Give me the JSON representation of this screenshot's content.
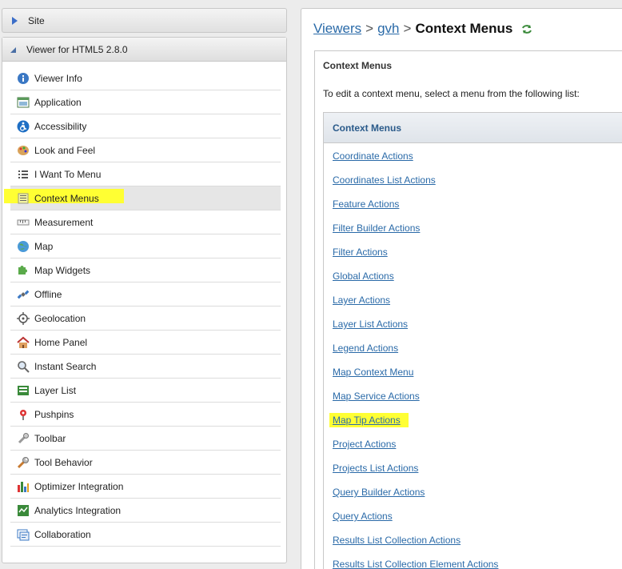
{
  "sidebar": {
    "site_label": "Site",
    "viewer_label": "Viewer for HTML5 2.8.0",
    "items": [
      {
        "label": "Viewer Info",
        "icon": "info-icon"
      },
      {
        "label": "Application",
        "icon": "application-icon"
      },
      {
        "label": "Accessibility",
        "icon": "accessibility-icon"
      },
      {
        "label": "Look and Feel",
        "icon": "palette-icon"
      },
      {
        "label": "I Want To Menu",
        "icon": "list-icon"
      },
      {
        "label": "Context Menus",
        "icon": "context-menu-icon"
      },
      {
        "label": "Measurement",
        "icon": "ruler-icon"
      },
      {
        "label": "Map",
        "icon": "globe-icon"
      },
      {
        "label": "Map Widgets",
        "icon": "puzzle-icon"
      },
      {
        "label": "Offline",
        "icon": "satellite-icon"
      },
      {
        "label": "Geolocation",
        "icon": "crosshair-icon"
      },
      {
        "label": "Home Panel",
        "icon": "home-icon"
      },
      {
        "label": "Instant Search",
        "icon": "search-icon"
      },
      {
        "label": "Layer List",
        "icon": "layers-icon"
      },
      {
        "label": "Pushpins",
        "icon": "pushpin-icon"
      },
      {
        "label": "Toolbar",
        "icon": "toolbar-icon"
      },
      {
        "label": "Tool Behavior",
        "icon": "wrench-icon"
      },
      {
        "label": "Optimizer Integration",
        "icon": "bar-chart-icon"
      },
      {
        "label": "Analytics Integration",
        "icon": "analytics-icon"
      },
      {
        "label": "Collaboration",
        "icon": "collaboration-icon"
      }
    ],
    "active_index": 5
  },
  "breadcrumb": {
    "viewers": "Viewers",
    "sep": ">",
    "gvh": "gvh",
    "current": "Context Menus"
  },
  "panel": {
    "title": "Context Menus",
    "description": "To edit a context menu, select a menu from the following list:",
    "list_header": "Context Menus",
    "menus": [
      "Coordinate Actions",
      "Coordinates List Actions",
      "Feature Actions",
      "Filter Builder Actions",
      "Filter Actions",
      "Global Actions",
      "Layer Actions",
      "Layer List Actions",
      "Legend Actions",
      "Map Context Menu",
      "Map Service Actions",
      "Map Tip Actions",
      "Project Actions",
      "Projects List Actions",
      "Query Builder Actions",
      "Query Actions",
      "Results List Collection Actions",
      "Results List Collection Element Actions"
    ],
    "highlighted_index": 11
  },
  "colors": {
    "highlight": "#ffff33",
    "link": "#2a6aa8"
  }
}
